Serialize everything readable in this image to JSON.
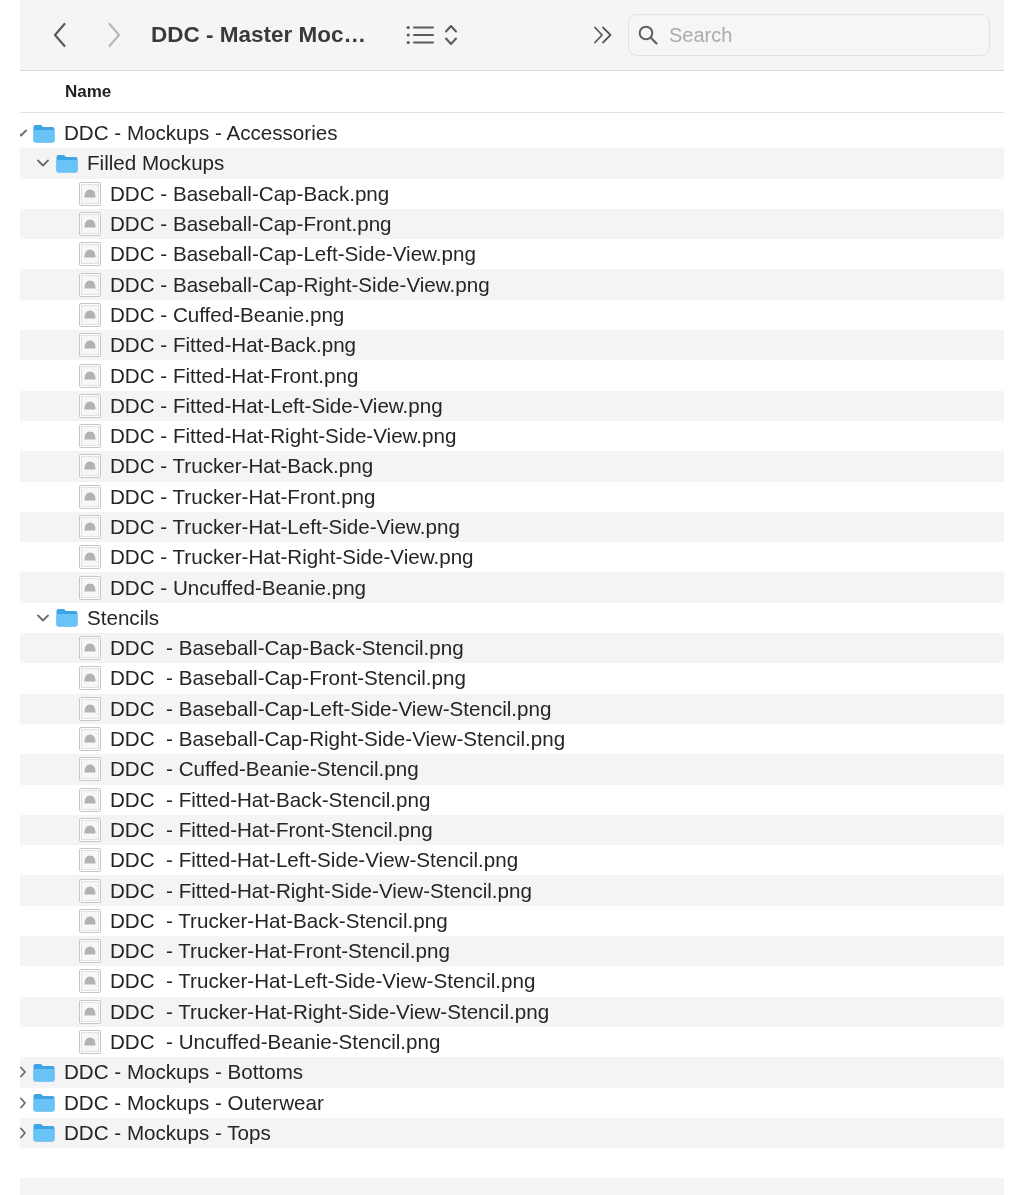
{
  "toolbar": {
    "back": {
      "disabled": false
    },
    "forward": {
      "disabled": true
    },
    "title": "DDC - Master Moc…",
    "search": {
      "placeholder": "Search"
    }
  },
  "columns": [
    {
      "label": "Name"
    }
  ],
  "tree": [
    {
      "kind": "folder",
      "name": "DDC - Mockups - Accessories",
      "expanded": true,
      "children": [
        {
          "kind": "folder",
          "name": "Filled Mockups",
          "expanded": true,
          "children": [
            {
              "kind": "file",
              "name": "DDC - Baseball-Cap-Back.png"
            },
            {
              "kind": "file",
              "name": "DDC - Baseball-Cap-Front.png"
            },
            {
              "kind": "file",
              "name": "DDC - Baseball-Cap-Left-Side-View.png"
            },
            {
              "kind": "file",
              "name": "DDC - Baseball-Cap-Right-Side-View.png"
            },
            {
              "kind": "file",
              "name": "DDC - Cuffed-Beanie.png"
            },
            {
              "kind": "file",
              "name": "DDC - Fitted-Hat-Back.png"
            },
            {
              "kind": "file",
              "name": "DDC - Fitted-Hat-Front.png"
            },
            {
              "kind": "file",
              "name": "DDC - Fitted-Hat-Left-Side-View.png"
            },
            {
              "kind": "file",
              "name": "DDC - Fitted-Hat-Right-Side-View.png"
            },
            {
              "kind": "file",
              "name": "DDC - Trucker-Hat-Back.png"
            },
            {
              "kind": "file",
              "name": "DDC - Trucker-Hat-Front.png"
            },
            {
              "kind": "file",
              "name": "DDC - Trucker-Hat-Left-Side-View.png"
            },
            {
              "kind": "file",
              "name": "DDC - Trucker-Hat-Right-Side-View.png"
            },
            {
              "kind": "file",
              "name": "DDC - Uncuffed-Beanie.png"
            }
          ]
        },
        {
          "kind": "folder",
          "name": "Stencils",
          "expanded": true,
          "children": [
            {
              "kind": "file",
              "name": "DDC  - Baseball-Cap-Back-Stencil.png"
            },
            {
              "kind": "file",
              "name": "DDC  - Baseball-Cap-Front-Stencil.png"
            },
            {
              "kind": "file",
              "name": "DDC  - Baseball-Cap-Left-Side-View-Stencil.png"
            },
            {
              "kind": "file",
              "name": "DDC  - Baseball-Cap-Right-Side-View-Stencil.png"
            },
            {
              "kind": "file",
              "name": "DDC  - Cuffed-Beanie-Stencil.png"
            },
            {
              "kind": "file",
              "name": "DDC  - Fitted-Hat-Back-Stencil.png"
            },
            {
              "kind": "file",
              "name": "DDC  - Fitted-Hat-Front-Stencil.png"
            },
            {
              "kind": "file",
              "name": "DDC  - Fitted-Hat-Left-Side-View-Stencil.png"
            },
            {
              "kind": "file",
              "name": "DDC  - Fitted-Hat-Right-Side-View-Stencil.png"
            },
            {
              "kind": "file",
              "name": "DDC  - Trucker-Hat-Back-Stencil.png"
            },
            {
              "kind": "file",
              "name": "DDC  - Trucker-Hat-Front-Stencil.png"
            },
            {
              "kind": "file",
              "name": "DDC  - Trucker-Hat-Left-Side-View-Stencil.png"
            },
            {
              "kind": "file",
              "name": "DDC  - Trucker-Hat-Right-Side-View-Stencil.png"
            },
            {
              "kind": "file",
              "name": "DDC  - Uncuffed-Beanie-Stencil.png"
            }
          ]
        }
      ]
    },
    {
      "kind": "folder",
      "name": "DDC - Mockups - Bottoms",
      "expanded": false
    },
    {
      "kind": "folder",
      "name": "DDC - Mockups - Outerwear",
      "expanded": false
    },
    {
      "kind": "folder",
      "name": "DDC - Mockups - Tops",
      "expanded": false
    }
  ]
}
